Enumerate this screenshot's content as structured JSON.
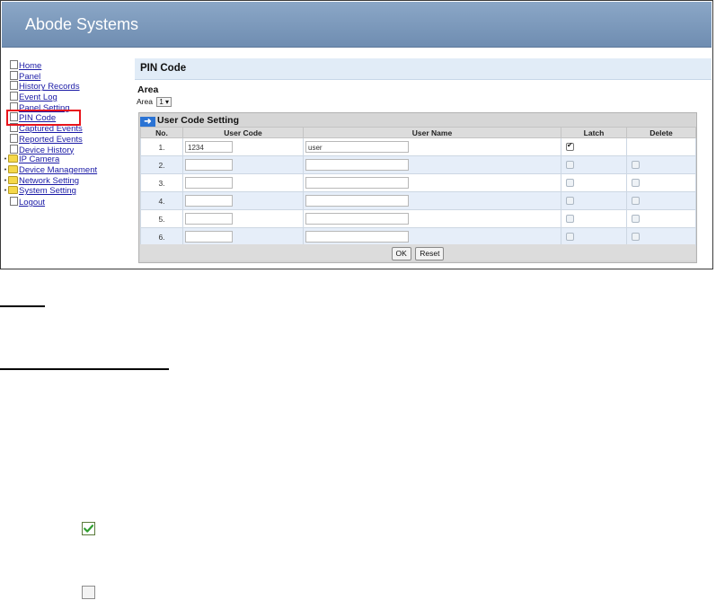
{
  "app": {
    "title": "Abode Systems"
  },
  "sidebar": {
    "items": [
      {
        "label": "Home",
        "icon": "file-icon",
        "expandable": false
      },
      {
        "label": "Panel",
        "icon": "file-icon",
        "expandable": false
      },
      {
        "label": "History Records",
        "icon": "file-icon",
        "expandable": false
      },
      {
        "label": "Event Log",
        "icon": "file-icon",
        "expandable": false
      },
      {
        "label": "Panel Setting",
        "icon": "file-icon",
        "expandable": false
      },
      {
        "label": "PIN Code",
        "icon": "file-icon",
        "expandable": false,
        "highlighted": true
      },
      {
        "label": "Captured Events",
        "icon": "file-icon",
        "expandable": false
      },
      {
        "label": "Reported Events",
        "icon": "file-icon",
        "expandable": false
      },
      {
        "label": "Device History",
        "icon": "file-icon",
        "expandable": false
      },
      {
        "label": "IP Camera",
        "icon": "folder-icon",
        "expandable": true
      },
      {
        "label": "Device Management",
        "icon": "folder-icon",
        "expandable": true
      },
      {
        "label": "Network Setting",
        "icon": "folder-icon",
        "expandable": true
      },
      {
        "label": "System Setting",
        "icon": "folder-icon",
        "expandable": true
      },
      {
        "label": "Logout",
        "icon": "file-icon",
        "expandable": false
      }
    ],
    "highlight_color": "#e8141c"
  },
  "main": {
    "page_title": "PIN Code",
    "area_heading": "Area",
    "area_label": "Area",
    "area_value": "1 ▾",
    "panel_title": "User Code Setting",
    "columns": [
      "No.",
      "User Code",
      "User Name",
      "Latch",
      "Delete"
    ],
    "rows": [
      {
        "no": "1.",
        "code": "1234",
        "name": "user",
        "latch": true,
        "delete": false
      },
      {
        "no": "2.",
        "code": "",
        "name": "",
        "latch": false,
        "delete": false
      },
      {
        "no": "3.",
        "code": "",
        "name": "",
        "latch": false,
        "delete": false
      },
      {
        "no": "4.",
        "code": "",
        "name": "",
        "latch": false,
        "delete": false
      },
      {
        "no": "5.",
        "code": "",
        "name": "",
        "latch": false,
        "delete": false
      },
      {
        "no": "6.",
        "code": "",
        "name": "",
        "latch": false,
        "delete": false
      }
    ],
    "ok_label": "OK",
    "reset_label": "Reset"
  },
  "legend": {
    "checked_icon": "checked-checkbox-icon",
    "unchecked_icon": "unchecked-checkbox-icon",
    "check_color": "#2e9e2e"
  }
}
